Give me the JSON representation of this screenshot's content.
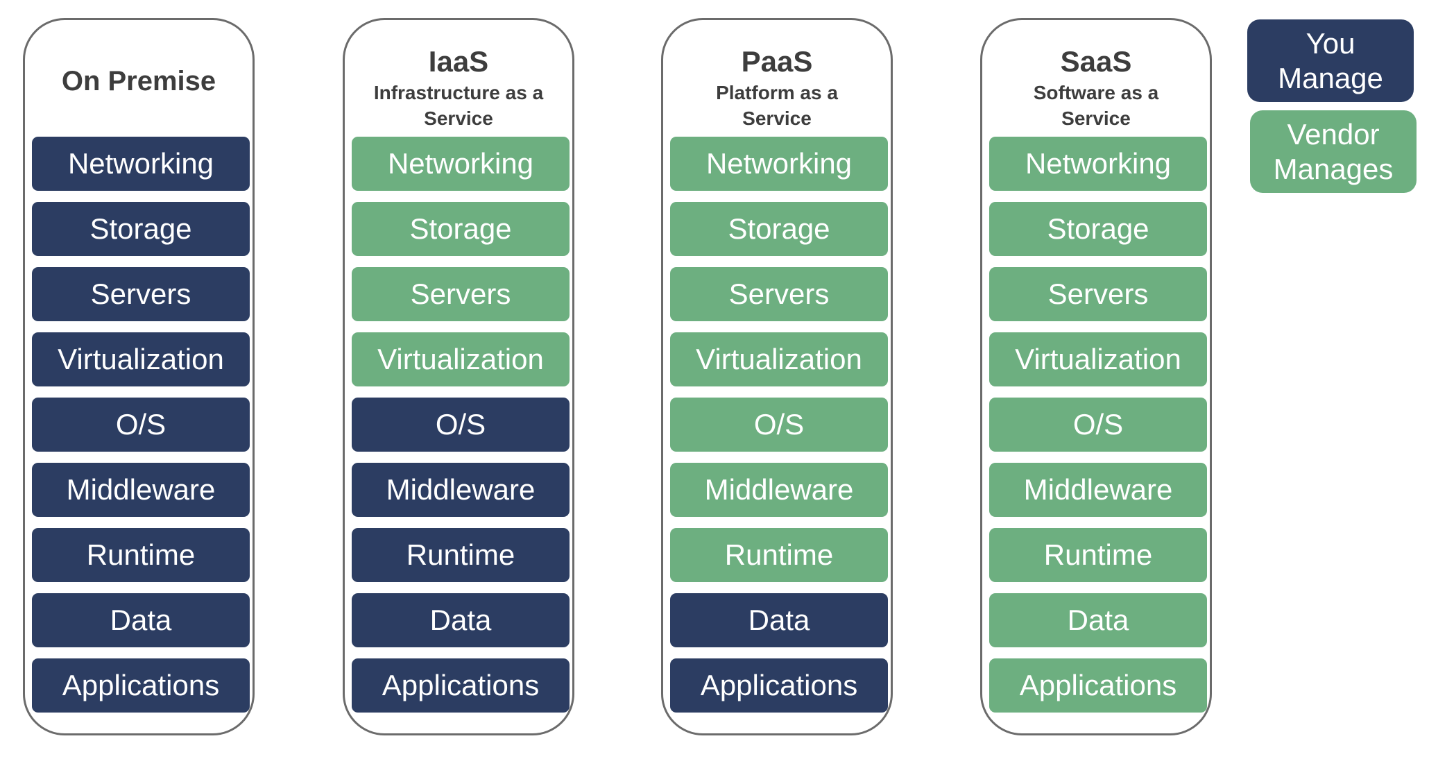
{
  "colors": {
    "you_manage": "#2c3d62",
    "vendor_manages": "#6daf80",
    "border": "#6b6b6b"
  },
  "layers": [
    "Networking",
    "Storage",
    "Servers",
    "Virtualization",
    "O/S",
    "Middleware",
    "Runtime",
    "Data",
    "Applications"
  ],
  "columns": [
    {
      "title": "On Premise",
      "subtitle": "",
      "managed_by": [
        "you",
        "you",
        "you",
        "you",
        "you",
        "you",
        "you",
        "you",
        "you"
      ]
    },
    {
      "title": "IaaS",
      "subtitle": "Infrastructure as a Service",
      "managed_by": [
        "vendor",
        "vendor",
        "vendor",
        "vendor",
        "you",
        "you",
        "you",
        "you",
        "you"
      ]
    },
    {
      "title": "PaaS",
      "subtitle": "Platform as a Service",
      "managed_by": [
        "vendor",
        "vendor",
        "vendor",
        "vendor",
        "vendor",
        "vendor",
        "vendor",
        "you",
        "you"
      ]
    },
    {
      "title": "SaaS",
      "subtitle": "Software as a Service",
      "managed_by": [
        "vendor",
        "vendor",
        "vendor",
        "vendor",
        "vendor",
        "vendor",
        "vendor",
        "vendor",
        "vendor"
      ]
    }
  ],
  "legend": {
    "you_manage": "You Manage",
    "vendor_manages": "Vendor Manages"
  }
}
